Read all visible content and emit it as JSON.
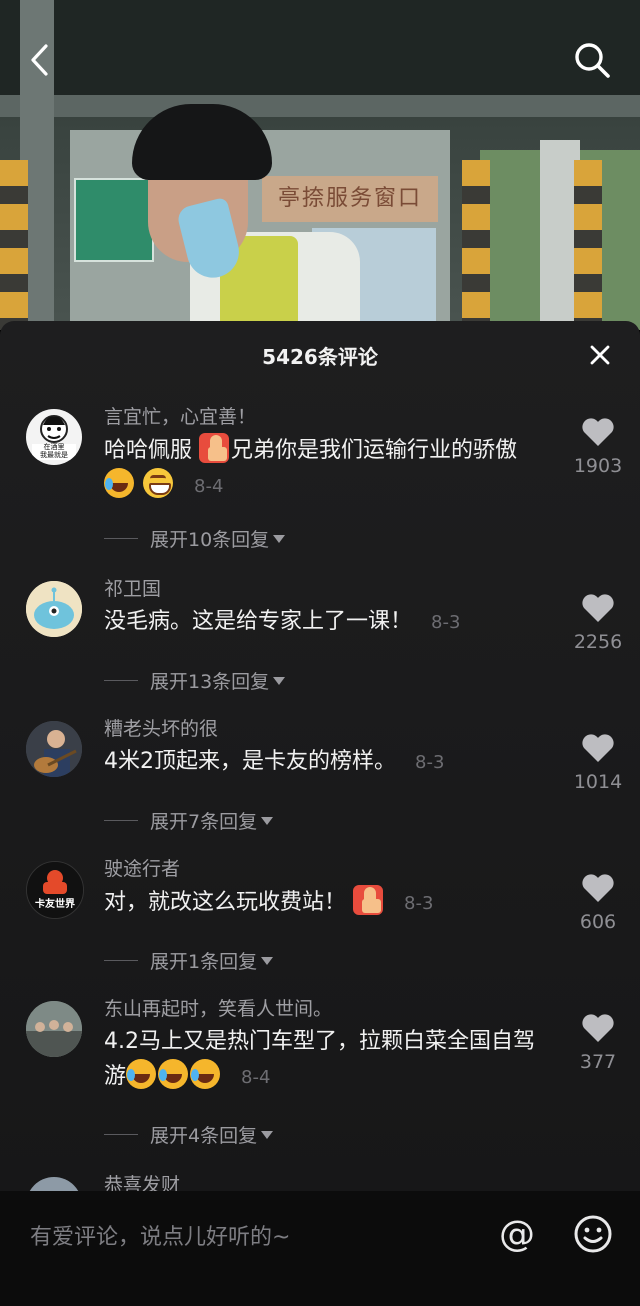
{
  "header": {
    "comment_count_title": "5426条评论"
  },
  "video": {
    "sign_text": "亭捺服务窗口"
  },
  "comments": [
    {
      "author": "言宜忙，心宜善！",
      "text": "哈哈佩服",
      "text_after_emoji": "兄弟你是我们运输行业的骄傲",
      "emojis": [
        "thumbs-up",
        "laughing-tears",
        "grinning"
      ],
      "date": "8-4",
      "replies_label": "展开10条回复",
      "likes": "1903",
      "avatar_text_1": "在酒里",
      "avatar_text_2": "我最就是"
    },
    {
      "author": "祁卫国",
      "text": "没毛病。这是给专家上了一课！",
      "date": "8-3",
      "replies_label": "展开13条回复",
      "likes": "2256"
    },
    {
      "author": "糟老头坏的很",
      "text": "4米2顶起来，是卡友的榜样。",
      "date": "8-3",
      "replies_label": "展开7条回复",
      "likes": "1014"
    },
    {
      "author": "驶途行者",
      "text": "对，就改这么玩收费站！",
      "emojis": [
        "thumbs-up"
      ],
      "date": "8-3",
      "replies_label": "展开1条回复",
      "likes": "606",
      "avatar_text": "卡友世界"
    },
    {
      "author": "东山再起时，笑看人世间。",
      "text": "4.2马上又是热门车型了，拉颗白菜全国自驾游",
      "emojis": [
        "laughing-tears",
        "laughing-tears",
        "laughing-tears"
      ],
      "date": "8-4",
      "replies_label": "展开4条回复",
      "likes": "377"
    },
    {
      "author": "恭喜发财"
    }
  ],
  "input": {
    "placeholder": "有爱评论，说点儿好听的~"
  },
  "icons": {
    "back": "back-arrow-icon",
    "search": "search-icon",
    "close": "close-icon",
    "like": "heart-icon",
    "at": "at-icon",
    "emoji": "emoji-icon"
  }
}
